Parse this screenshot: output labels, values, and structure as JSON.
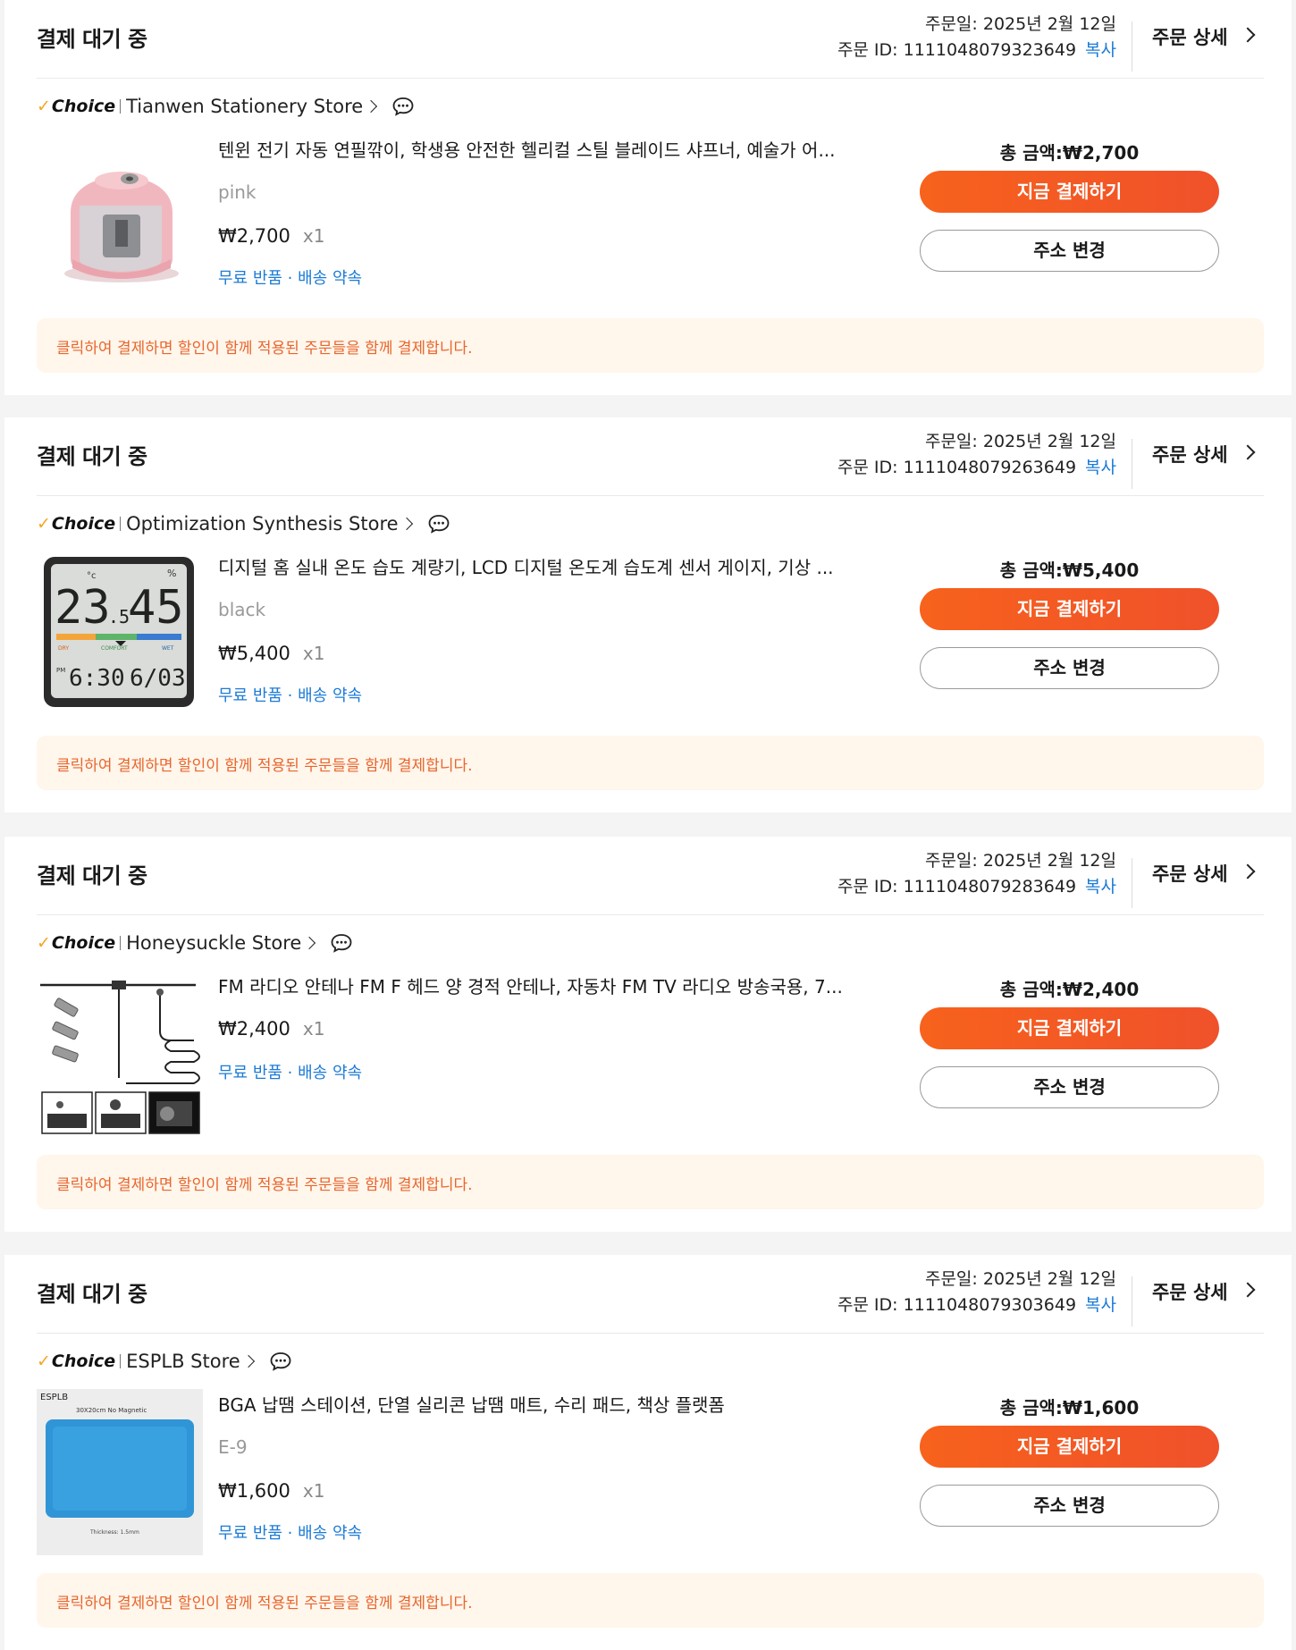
{
  "colors": {
    "accent_orange": "#f7621c",
    "link_blue": "#1c7bd6",
    "notice_bg": "#fff6ec",
    "notice_text": "#e8662d",
    "choice_check": "#f5a623"
  },
  "orders": [
    {
      "status": "결제 대기 중",
      "order_date": "주문일: 2025년 2월 12일",
      "order_id": "주문 ID: 1111048079323649",
      "copy_label": "복사",
      "detail_label": "주문 상세",
      "choice_label": "Choice",
      "store_name": "Tianwen Stationery Store",
      "product_image": "pink-electric-pencil-sharpener",
      "product_title": "텐윈 전기 자동 연필깎이, 학생용 안전한 헬리컬 스틸 블레이드 샤프너, 예술가 어...",
      "variant": "pink",
      "price": "₩2,700",
      "qty": "x1",
      "benefits": "무료 반품 · 배송 약속",
      "total": "총 금액:₩2,700",
      "pay_label": "지금 결제하기",
      "address_label": "주소 변경",
      "notice": "클릭하여 결제하면 할인이 함께 적용된 주문들을 함께 결제합니다."
    },
    {
      "status": "결제 대기 중",
      "order_date": "주문일: 2025년 2월 12일",
      "order_id": "주문 ID: 1111048079263649",
      "copy_label": "복사",
      "detail_label": "주문 상세",
      "choice_label": "Choice",
      "store_name": "Optimization Synthesis Store",
      "product_image": "digital-thermometer-hygrometer",
      "product_title": "디지털 홈 실내 온도 습도 계량기, LCD 디지털 온도계 습도계 센서 게이지, 기상 ...",
      "variant": "black",
      "price": "₩5,400",
      "qty": "x1",
      "benefits": "무료 반품 · 배송 약속",
      "total": "총 금액:₩5,400",
      "pay_label": "지금 결제하기",
      "address_label": "주소 변경",
      "notice": "클릭하여 결제하면 할인이 함께 적용된 주문들을 함께 결제합니다.",
      "device": {
        "temp_main": "23",
        "temp_dec": ".5",
        "temp_unit": "°c",
        "humidity": "45",
        "humidity_unit": "%",
        "comfort_dry": "DRY",
        "comfort_mid": "COMFORT",
        "comfort_wet": "WET",
        "pm": "PM",
        "clock": "6:30",
        "date": "6/03"
      }
    },
    {
      "status": "결제 대기 중",
      "order_date": "주문일: 2025년 2월 12일",
      "order_id": "주문 ID: 1111048079283649",
      "copy_label": "복사",
      "detail_label": "주문 상세",
      "choice_label": "Choice",
      "store_name": "Honeysuckle Store",
      "product_image": "fm-radio-antenna",
      "product_title": "FM 라디오 안테나 FM F 헤드 양 경적 안테나, 자동차 FM TV 라디오 방송국용, 7...",
      "variant": "",
      "price": "₩2,400",
      "qty": "x1",
      "benefits": "무료 반품 · 배송 약속",
      "total": "총 금액:₩2,400",
      "pay_label": "지금 결제하기",
      "address_label": "주소 변경",
      "notice": "클릭하여 결제하면 할인이 함께 적용된 주문들을 함께 결제합니다."
    },
    {
      "status": "결제 대기 중",
      "order_date": "주문일: 2025년 2월 12일",
      "order_id": "주문 ID: 1111048079303649",
      "copy_label": "복사",
      "detail_label": "주문 상세",
      "choice_label": "Choice",
      "store_name": "ESPLB Store",
      "product_image": "blue-silicone-solder-mat",
      "product_title": "BGA 납땜 스테이션, 단열 실리콘 납땜 매트, 수리 패드, 책상 플랫폼",
      "variant": "E-9",
      "price": "₩1,600",
      "qty": "x1",
      "benefits": "무료 반품 · 배송 약속",
      "total": "총 금액:₩1,600",
      "pay_label": "지금 결제하기",
      "address_label": "주소 변경",
      "notice": "클릭하여 결제하면 할인이 함께 적용된 주문들을 함께 결제합니다.",
      "mat": {
        "brand": "ESPLB",
        "size_note": "30X20cm  No Magnetic",
        "thickness": "Thickness: 1.5mm"
      }
    }
  ]
}
